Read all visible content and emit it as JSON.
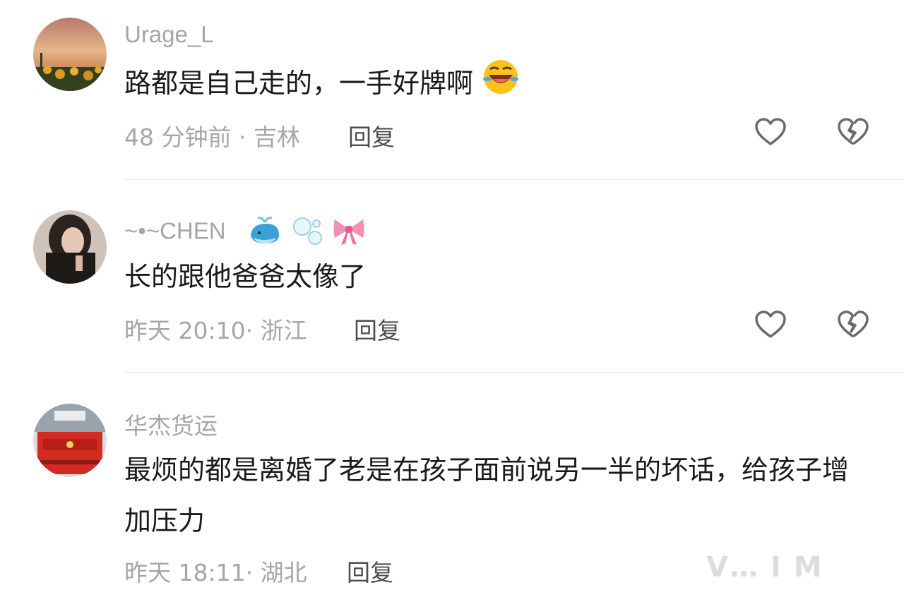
{
  "comments": [
    {
      "username": "Urage_L",
      "text": "路都是自己走的，一手好牌啊",
      "meta": "48 分钟前 · 吉林",
      "reply_label": "回复"
    },
    {
      "username": "~•~CHEN",
      "text": "长的跟他爸爸太像了",
      "meta": "昨天 20:10· 浙江",
      "reply_label": "回复"
    },
    {
      "username": "华杰货运",
      "text": "最烦的都是离婚了老是在孩子面前说另一半的坏话，给孩子增加压力",
      "meta": "昨天 18:11· 湖北",
      "reply_label": "回复"
    }
  ],
  "icons": {
    "like": "heart-outline-icon",
    "dislike": "broken-heart-icon",
    "emoji_1": "rofl-emoji",
    "emoji_2": "whale-emoji",
    "emoji_3": "bubbles-emoji",
    "emoji_4": "bow-emoji"
  },
  "colors": {
    "username": "#a6a6a6",
    "text": "#1a1a1a",
    "reply": "#4d4d4d",
    "icon": "#6b6b6b"
  },
  "watermark": "V… I  M"
}
